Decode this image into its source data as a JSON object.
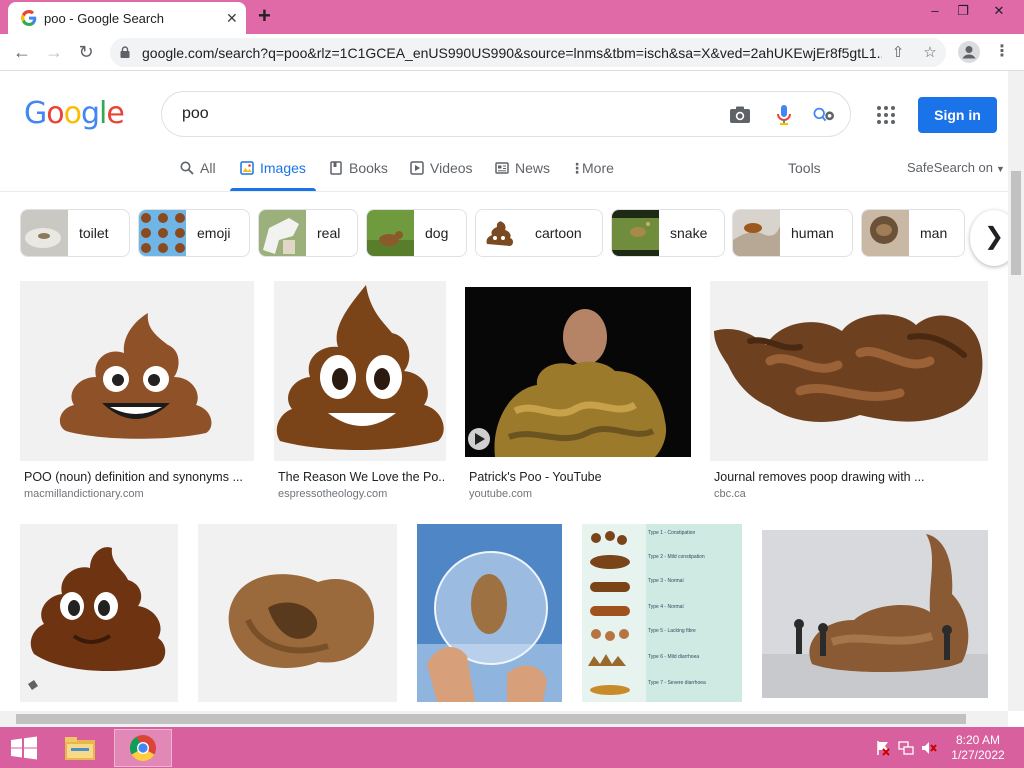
{
  "browser": {
    "tab_title": "poo - Google Search",
    "tab_close": "✕",
    "new_tab": "+",
    "window_controls": [
      "–",
      "❐",
      "✕"
    ],
    "url": "google.com/search?q=poo&rlz=1C1GCEA_enUS990US990&source=lnms&tbm=isch&sa=X&ved=2ahUKEwjEr8f5gtL1..."
  },
  "google": {
    "logo_letters": [
      {
        "char": "G",
        "color": "#4285f4"
      },
      {
        "char": "o",
        "color": "#ea4335"
      },
      {
        "char": "o",
        "color": "#fbbc05"
      },
      {
        "char": "g",
        "color": "#4285f4"
      },
      {
        "char": "l",
        "color": "#34a853"
      },
      {
        "char": "e",
        "color": "#ea4335"
      }
    ],
    "query": "poo",
    "sign_in": "Sign in",
    "nav_tabs": [
      {
        "label": "All",
        "icon": "search-icon",
        "active": false
      },
      {
        "label": "Images",
        "icon": "image-icon",
        "active": true
      },
      {
        "label": "Books",
        "icon": "book-icon",
        "active": false
      },
      {
        "label": "Videos",
        "icon": "play-icon",
        "active": false
      },
      {
        "label": "News",
        "icon": "news-icon",
        "active": false
      },
      {
        "label": "More",
        "icon": "more-vert-icon",
        "active": false
      }
    ],
    "tools": "Tools",
    "safesearch": "SafeSearch on",
    "accent_color": "#1a73e8"
  },
  "chips": [
    {
      "label": "toilet"
    },
    {
      "label": "emoji"
    },
    {
      "label": "real"
    },
    {
      "label": "dog"
    },
    {
      "label": "cartoon"
    },
    {
      "label": "snake"
    },
    {
      "label": "human"
    },
    {
      "label": "man"
    }
  ],
  "results_row1": [
    {
      "caption": "POO (noun) definition and synonyms ...",
      "source": "macmillandictionary.com",
      "kind": "emoji"
    },
    {
      "caption": "The Reason We Love the Po...",
      "source": "espressotheology.com",
      "kind": "emoji"
    },
    {
      "caption": "Patrick's Poo - YouTube",
      "source": "youtube.com",
      "kind": "video"
    },
    {
      "caption": "Journal removes poop drawing with ...",
      "source": "cbc.ca",
      "kind": "drawing"
    }
  ],
  "results_row2": [
    {
      "kind": "toy"
    },
    {
      "kind": "real"
    },
    {
      "kind": "globe"
    },
    {
      "kind": "chart"
    },
    {
      "kind": "sculpture"
    }
  ],
  "chart_labels": [
    "Type 1 - Constipation",
    "Type 2 - Mild constipation",
    "Type 3 - Normal",
    "Type 4 - Normal",
    "Type 5 - Lacking fibre",
    "Type 6 - Mild diarrhoea",
    "Type 7 - Severe diarrhoea"
  ],
  "taskbar": {
    "time": "8:20 AM",
    "date": "1/27/2022"
  }
}
